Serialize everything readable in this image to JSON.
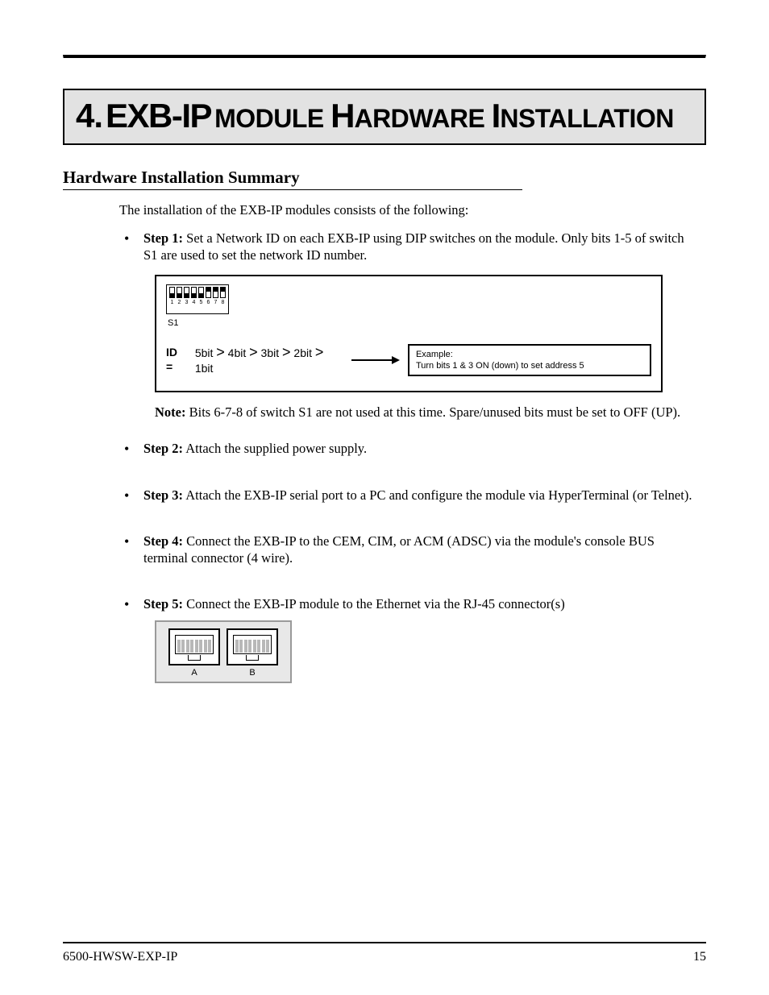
{
  "title": {
    "number": "4.",
    "text_parts": [
      "EXB-IP",
      " ",
      "MODULE",
      " ",
      "H",
      "ARDWARE",
      " ",
      "I",
      "NSTALLATION"
    ]
  },
  "section_heading": "Hardware Installation Summary",
  "lead": "The installation of the EXB-IP modules consists of the following:",
  "steps": [
    {
      "title": "Step 1:",
      "body": " Set a Network ID on each EXB-IP using DIP switches on the module. Only bits 1-5 of switch S1 are used to set the network ID number."
    },
    {
      "title": "Step 2:",
      "body": " Attach the supplied power supply."
    },
    {
      "title": "Step 3:",
      "body": " Attach the EXB-IP serial port to a PC and configure the module via HyperTerminal (or Telnet)."
    },
    {
      "title": "Step 4:",
      "body": " Connect the EXB-IP to the CEM, CIM, or ACM (ADSC) via the module's console BUS terminal connector (4 wire)."
    },
    {
      "title": "Step 5:",
      "body": " Connect the EXB-IP module to the Ethernet via the RJ-45 connector(s)"
    }
  ],
  "dip": {
    "caption": "S1",
    "numbers": [
      "1",
      "2",
      "3",
      "4",
      "5",
      "6",
      "7",
      "8"
    ],
    "states": [
      "down",
      "down",
      "down",
      "down",
      "down",
      "up",
      "up",
      "up"
    ]
  },
  "diagram": {
    "id_label": "ID =",
    "formula_html": "5bit | 4bit | 3bit | 2bit | 1bit",
    "formula_plain": "5bit > 4bit > 3bit > 2bit > 1bit",
    "example_lines": [
      "Example:",
      "Turn bits 1 & 3 ON (down) to set address 5"
    ]
  },
  "note": {
    "label": "Note:",
    "body": " Bits 6-7-8 of switch S1 are not used at this time. Spare/unused bits must be set to OFF (UP)."
  },
  "rj": {
    "a": "A",
    "b": "B"
  },
  "footer": {
    "left": "6500-HWSW-EXP-IP",
    "right": "15"
  }
}
